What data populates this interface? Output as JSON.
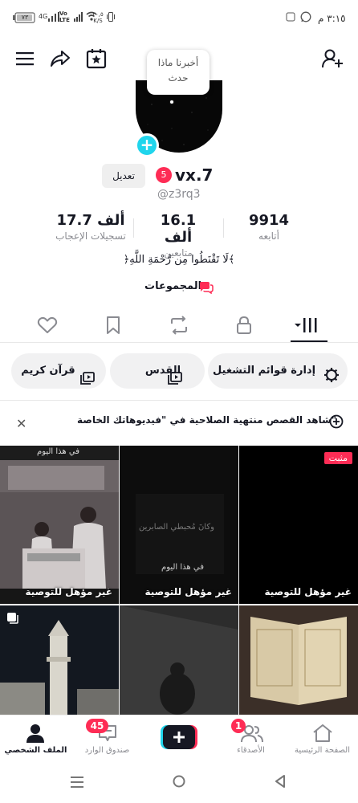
{
  "status_bar": {
    "time": "٣:١٥ م",
    "network_speed": "٢٠,٥ K/S",
    "battery": "٧٣",
    "signal": "4G"
  },
  "header": {
    "tooltip_text": "أخبرنا ماذا حدث"
  },
  "profile": {
    "edit_label": "تعديل",
    "verified_count": "5",
    "username": "vx.7",
    "handle": "@z3rq3",
    "stats": [
      {
        "number": "9914",
        "label": "أتابعه"
      },
      {
        "number": "16.1 ألف",
        "label": "متابعين"
      },
      {
        "number": "17.7 ألف",
        "label": "تسجيلات الإعجاب"
      }
    ],
    "bio": "﴿لَا تَقْنَطُوا مِن رَّحْمَةِ اللَّهِ﴾",
    "groups_label": "المجموعات"
  },
  "playlists": [
    {
      "label": "إدارة قوائم التشغيل"
    },
    {
      "label": "القدس"
    },
    {
      "label": "قرآن كريم"
    }
  ],
  "banner": {
    "text": "شاهد القصص منتهية الصلاحية في \"فيديوهاتك الخاصة\""
  },
  "grid": {
    "pinned_label": "مثبت",
    "tiles": [
      {
        "label": "غير مؤهل للتوصية",
        "overlay_title": "في هذا اليوم"
      },
      {
        "label": "غير مؤهل للتوصية",
        "overlay_title": "في هذا اليوم",
        "overlay_sub": "وكانَ مُحبطي الصابرين"
      },
      {
        "label": "غير مؤهل للتوصية"
      }
    ]
  },
  "bottom_nav": {
    "profile": "الملف الشخصي",
    "inbox": "صندوق الوارد",
    "inbox_badge": "45",
    "friends": "الأصدقاء",
    "friends_badge": "1",
    "home": "الصفحة الرئيسية"
  },
  "colors": {
    "accent": "#fe2c55",
    "cyan": "#20d5ec",
    "text": "#161823",
    "muted": "#8a8b91"
  }
}
